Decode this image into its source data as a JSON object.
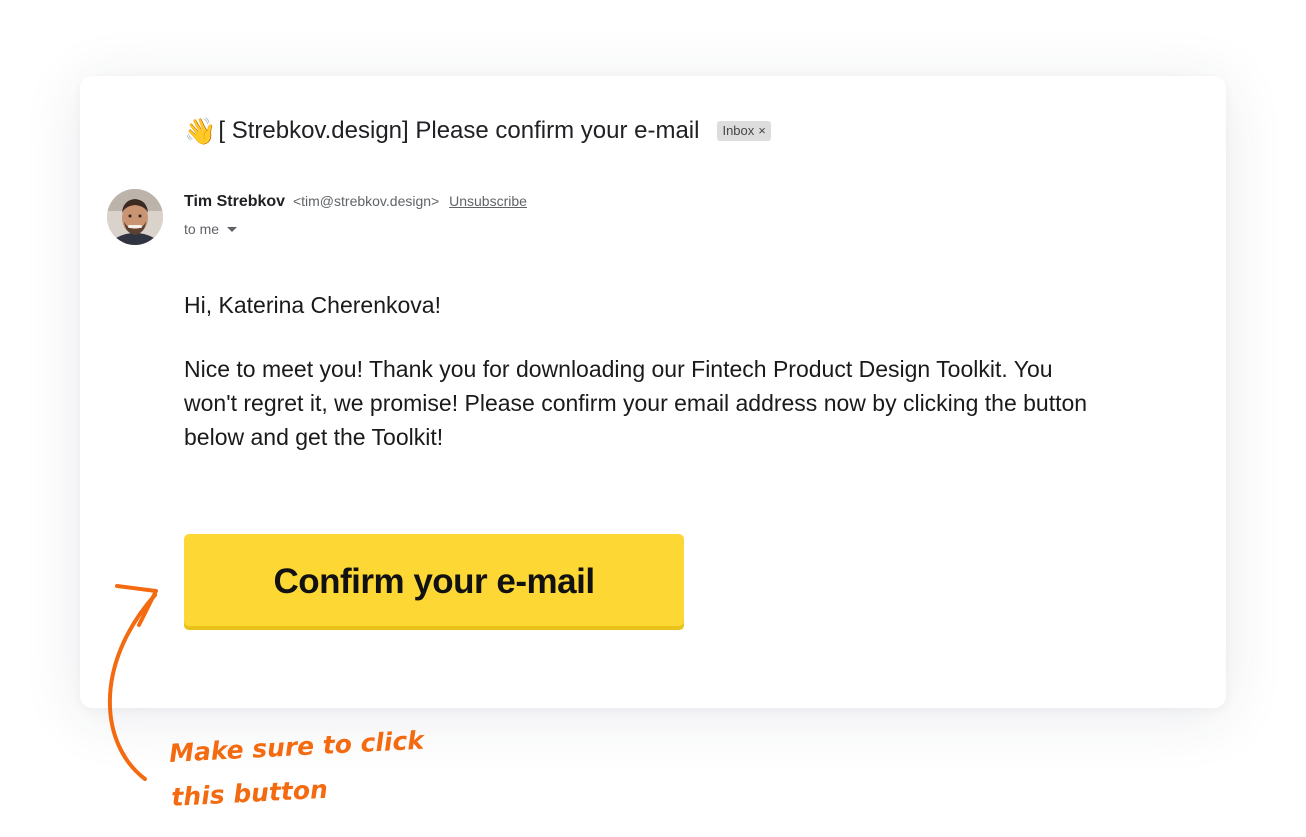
{
  "email": {
    "subject_emoji": "👋",
    "subject": "[ Strebkov.design] Please confirm your e-mail",
    "label": "Inbox",
    "label_remove": "×",
    "sender": {
      "name": "Tim Strebkov",
      "email": "<tim@strebkov.design>",
      "unsubscribe": "Unsubscribe",
      "recipient": "to me"
    },
    "greeting": "Hi, Katerina Cherenkova!",
    "body": "Nice to meet you! Thank you for downloading our Fintech Product Design Toolkit. You won't regret it, we promise! Please confirm your email address now by clicking the button below and get the Toolkit!",
    "cta_label": "Confirm your e-mail"
  },
  "annotation": {
    "line1": "Make sure to click",
    "line2": "this button"
  },
  "colors": {
    "cta": "#fdd835",
    "annotation": "#f36a10"
  },
  "icons": {
    "label_remove": "close-icon",
    "recipient_toggle": "caret-down-icon",
    "annotation": "curved-arrow-icon"
  }
}
